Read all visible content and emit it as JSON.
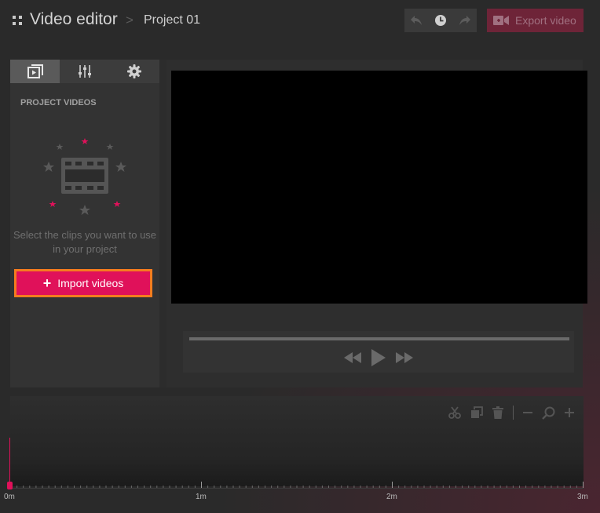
{
  "header": {
    "app_title": "Video editor",
    "breadcrumb_separator": ">",
    "project_name": "Project 01",
    "export_label": "Export video",
    "icons": [
      "undo-icon",
      "history-icon",
      "redo-icon",
      "video-camera-icon"
    ]
  },
  "left_panel": {
    "tabs": [
      {
        "name": "media",
        "icon": "media-library-icon",
        "active": true
      },
      {
        "name": "adjustments",
        "icon": "sliders-icon",
        "active": false
      },
      {
        "name": "settings",
        "icon": "gear-icon",
        "active": false
      }
    ],
    "section_title": "PROJECT VIDEOS",
    "empty_text": "Select the clips you want to use in your project",
    "import_label": "Import videos",
    "import_icon": "+"
  },
  "player": {
    "icons": [
      "rewind-icon",
      "play-icon",
      "fast-forward-icon"
    ]
  },
  "timeline": {
    "tools": [
      "cut-icon",
      "duplicate-icon",
      "delete-icon",
      "zoom-out-icon",
      "zoom-icon",
      "zoom-in-icon"
    ],
    "ruler_labels": [
      "0m",
      "1m",
      "2m",
      "3m"
    ]
  },
  "colors": {
    "accent": "#e0115a",
    "highlight_border": "#f57c1f",
    "export_bg": "#6e2438",
    "background": "#2a2a2a",
    "panel": "#333333"
  }
}
